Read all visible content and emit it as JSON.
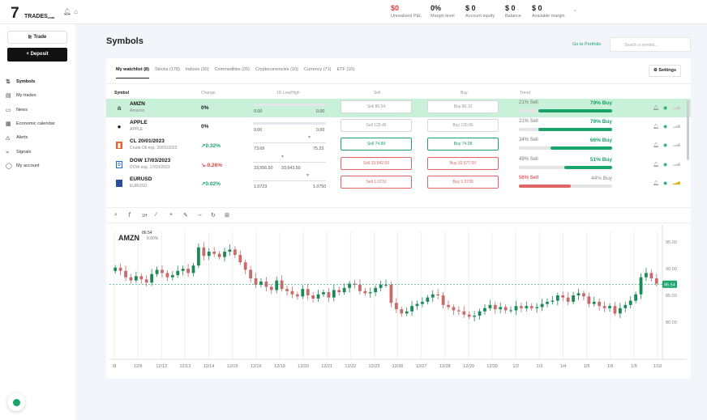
{
  "brand": {
    "logo_num": "7",
    "logo_text": "TRADES",
    "logo_suffix": ".com"
  },
  "header": {
    "metrics": [
      {
        "value": "$0",
        "label": "Unrealized P&L",
        "color": "#e04040"
      },
      {
        "value": "0%",
        "label": "Margin level",
        "color": "#222"
      },
      {
        "value": "$ 0",
        "label": "Account equity",
        "color": "#222"
      },
      {
        "value": "$ 0",
        "label": "Balance",
        "color": "#222"
      },
      {
        "value": "$ 0",
        "label": "Available margin",
        "color": "#222"
      }
    ]
  },
  "sidebar": {
    "trade_label": "Trade",
    "deposit_label": "Deposit",
    "items": [
      {
        "label": "Symbols",
        "icon": "swap-icon",
        "active": true
      },
      {
        "label": "My trades",
        "icon": "trades-icon",
        "active": false
      },
      {
        "label": "News",
        "icon": "news-icon",
        "active": false
      },
      {
        "label": "Economic calendar",
        "icon": "calendar-icon",
        "active": false
      },
      {
        "label": "Alerts",
        "icon": "bell-icon",
        "active": false
      },
      {
        "label": "Signals",
        "icon": "signal-icon",
        "active": false
      },
      {
        "label": "My account",
        "icon": "user-icon",
        "active": false
      }
    ]
  },
  "page": {
    "title": "Symbols",
    "portfolio_link": "Go to Portfolio",
    "search_placeholder": "Search a symbol..."
  },
  "tabs": [
    "My watchlist (8)",
    "Stocks (178)",
    "Indices (30)",
    "Commodities (25)",
    "Cryptocurrencies (10)",
    "Currency (71)",
    "ETF (10)"
  ],
  "settings_label": "Settings",
  "columns": [
    "Symbol",
    "Change",
    "1D Low/High",
    "Sell",
    "Buy",
    "Trend"
  ],
  "rows": [
    {
      "name": "AMZN",
      "sub": "Amazon",
      "change": "0%",
      "change_color": "#222",
      "low": "0.00",
      "high": "0.00",
      "sell": "Sell 86.54",
      "buy": "Buy 86.10",
      "sell_style": "gl",
      "buy_style": "gl",
      "sell_pct": "21% Sell",
      "buy_pct": "79% Buy",
      "buy_fraction": 0.79,
      "trend_color": "#1aa36b",
      "selected": true,
      "logo": "a"
    },
    {
      "name": "APPLE",
      "sub": "APPLE",
      "change": "0%",
      "change_color": "#222",
      "low": "0.00",
      "high": "0.00",
      "sell": "Sell 129.46",
      "buy": "Buy 130.86",
      "sell_style": "gl",
      "buy_style": "gl",
      "sell_pct": "21% Sell",
      "buy_pct": "79% Buy",
      "buy_fraction": 0.79,
      "trend_color": "#1aa36b",
      "selected": false,
      "logo": ""
    },
    {
      "name": "CL 20/01/2023",
      "sub": "Crude Oil exp. 20/01/2023",
      "change": "↗0.32%",
      "change_color": "#1aa36b",
      "low": "73.69",
      "high": "75.23",
      "sell": "Sell 74.88",
      "buy": "Buy 74.98",
      "sell_style": "g",
      "buy_style": "g",
      "sell_pct": "34% Sell",
      "buy_pct": "66% Buy",
      "buy_fraction": 0.66,
      "trend_color": "#1aa36b",
      "selected": false,
      "logo": "▮"
    },
    {
      "name": "DOW 17/03/2023",
      "sub": "DOW exp. 17/03/2023",
      "change": "↘-0.26%",
      "change_color": "#e04040",
      "low": "33,556.50",
      "high": "33,643.50",
      "sell": "Sell 33,542.00",
      "buy": "Buy 33,577.00",
      "sell_style": "r",
      "buy_style": "r",
      "sell_pct": "49% Sell",
      "buy_pct": "51% Buy",
      "buy_fraction": 0.51,
      "trend_color": "#1aa36b",
      "selected": false,
      "logo": "D"
    },
    {
      "name": "EURUSD",
      "sub": "EURUSD",
      "change": "↗0.02%",
      "change_color": "#1aa36b",
      "low": "1.0723",
      "high": "1.0750",
      "sell": "Sell 1.0731",
      "buy": "Buy 1.0739",
      "sell_style": "r",
      "buy_style": "r",
      "sell_pct": "56% Sell",
      "buy_pct": "44% Buy",
      "buy_fraction": 0.44,
      "trend_color": "#e06565",
      "selected": false,
      "logo": ""
    }
  ],
  "chart_toolbar": [
    "search-icon",
    "indicator-icon",
    "timeframe-icon",
    "line-tool-icon",
    "crosshair-icon",
    "draw-icon",
    "measure-icon",
    "refresh-icon",
    "grid-icon"
  ],
  "chart_toolbar_text": "1H",
  "chart_data": {
    "type": "candlestick",
    "title": "AMZN",
    "last_price": "86.54",
    "change": "0.00%",
    "price_label": "86.54",
    "ylim": [
      79.5,
      91.5
    ],
    "yticks": [
      "95.00",
      "90.00",
      "85.00",
      "80.00"
    ],
    "ytick_values": [
      90.5,
      88.0,
      85.5,
      83.0
    ],
    "xticks": [
      "/8",
      "12/9",
      "12/12",
      "12/13",
      "12/14",
      "12/15",
      "12/16",
      "12/19",
      "12/20",
      "12/21",
      "12/22",
      "12/23",
      "12/26",
      "12/27",
      "12/28",
      "12/29",
      "12/30",
      "1/2",
      "1/3",
      "1/4",
      "1/5",
      "1/6",
      "1/9",
      "1/10"
    ],
    "closes": [
      88.1,
      87.8,
      87.2,
      86.9,
      87.3,
      87.0,
      86.7,
      87.5,
      87.9,
      87.6,
      87.2,
      87.4,
      87.8,
      88.0,
      87.6,
      88.3,
      90.0,
      89.2,
      89.6,
      89.4,
      89.1,
      89.6,
      89.8,
      89.3,
      88.6,
      87.9,
      87.1,
      86.5,
      86.8,
      86.3,
      86.0,
      86.9,
      86.1,
      85.9,
      85.6,
      85.4,
      86.1,
      85.5,
      85.2,
      85.6,
      85.8,
      85.3,
      86.0,
      85.8,
      86.2,
      86.6,
      86.5,
      85.9,
      85.7,
      85.8,
      86.2,
      86.5,
      86.5,
      84.8,
      84.2,
      83.8,
      84.0,
      84.5,
      84.7,
      84.9,
      85.3,
      85.6,
      85.5,
      84.6,
      84.4,
      84.1,
      84.0,
      83.7,
      83.5,
      83.6,
      84.0,
      84.3,
      84.6,
      84.2,
      84.4,
      84.1,
      84.1,
      84.5,
      84.3,
      84.5,
      84.3,
      84.4,
      84.7,
      84.9,
      85.0,
      85.5,
      85.3,
      84.9,
      85.5,
      85.7,
      85.4,
      84.7,
      84.9,
      84.5,
      84.3,
      84.5,
      83.8,
      84.3,
      84.6,
      85.0,
      85.6,
      87.2,
      87.6,
      87.1,
      86.6
    ]
  }
}
